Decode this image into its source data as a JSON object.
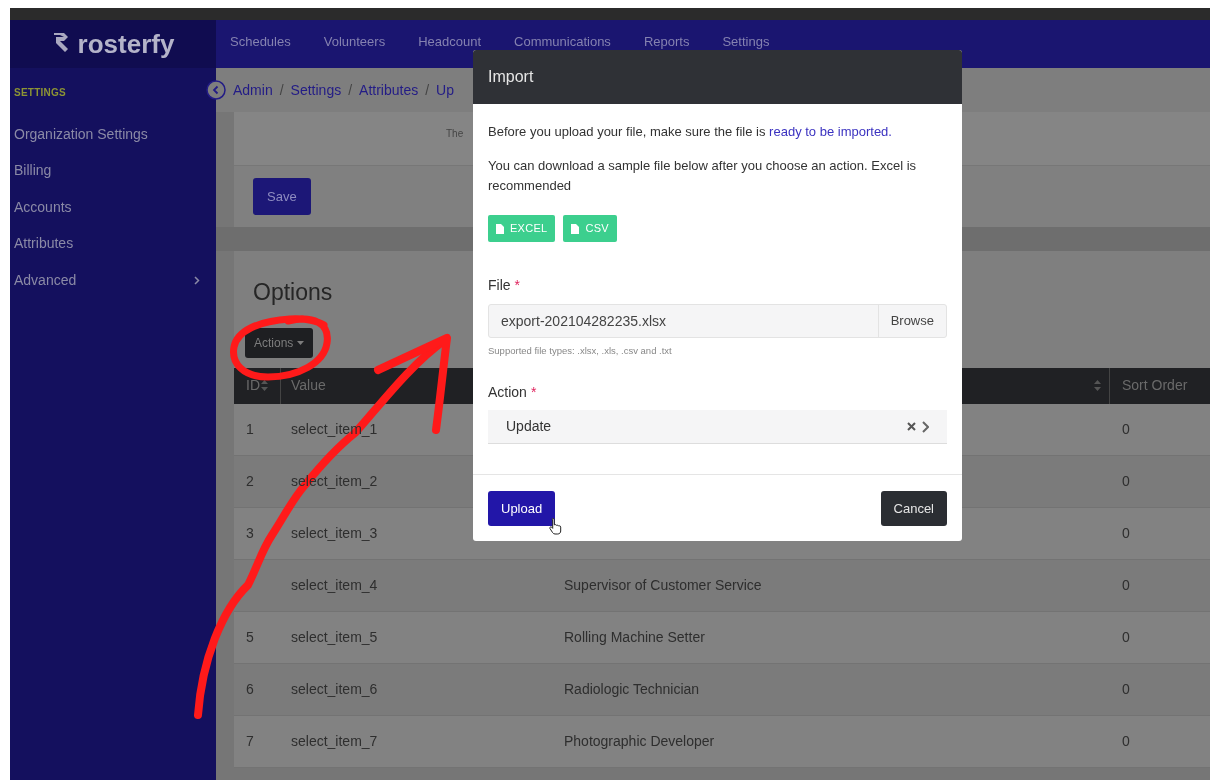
{
  "header": {
    "logo": "rosterfy",
    "nav": [
      {
        "label": "Schedules"
      },
      {
        "label": "Volunteers"
      },
      {
        "label": "Headcount"
      },
      {
        "label": "Communications"
      },
      {
        "label": "Reports"
      },
      {
        "label": "Settings"
      }
    ]
  },
  "sidebar": {
    "heading": "SETTINGS",
    "items": [
      {
        "label": "Organization Settings",
        "has_submenu": false
      },
      {
        "label": "Billing",
        "has_submenu": false
      },
      {
        "label": "Accounts",
        "has_submenu": false
      },
      {
        "label": "Attributes",
        "has_submenu": false
      },
      {
        "label": "Advanced",
        "has_submenu": true
      }
    ]
  },
  "breadcrumb": [
    {
      "kind": "link",
      "text": "Admin"
    },
    {
      "kind": "separator",
      "text": "/"
    },
    {
      "kind": "link",
      "text": "Settings"
    },
    {
      "kind": "separator",
      "text": "/"
    },
    {
      "kind": "link",
      "text": "Attributes"
    },
    {
      "kind": "separator",
      "text": "/"
    },
    {
      "kind": "link",
      "text": "Up"
    }
  ],
  "notice": "The",
  "save_button": "Save",
  "options": {
    "title": "Options",
    "actions_button": "Actions",
    "headers": {
      "id": "ID",
      "value": "Value",
      "sort_order": "Sort Order"
    },
    "rows": [
      {
        "id": "1",
        "value": "select_item_1",
        "sort_order": "0"
      },
      {
        "id": "2",
        "value": "select_item_2",
        "sort_order": "0"
      },
      {
        "id": "3",
        "value": "select_item_3",
        "sort_order": "0"
      },
      {
        "value": "select_item_4",
        "column_3": "Supervisor of Customer Service",
        "sort_order": "0"
      },
      {
        "id": "5",
        "value": "select_item_5",
        "column_3": "Rolling Machine Setter",
        "sort_order": "0"
      },
      {
        "id": "6",
        "value": "select_item_6",
        "column_3": "Radiologic Technician",
        "sort_order": "0"
      },
      {
        "id": "7",
        "value": "select_item_7",
        "column_3": "Photographic Developer",
        "sort_order": "0"
      }
    ]
  },
  "modal": {
    "title": "Import",
    "intro": "Before you upload your file, make sure the file is",
    "intro_link": "ready to be imported.",
    "sample_note": "You can download a sample file below after you choose an action. Excel is recommended",
    "sample_buttons": [
      "EXCEL",
      "CSV"
    ],
    "file": {
      "label": "File",
      "required_mark": "*",
      "value": "export-202104282235.xlsx",
      "browse": "Browse",
      "hint": "Supported file types: .xlsx, .xls, .csv and .txt"
    },
    "action": {
      "label": "Action",
      "required_mark": "*",
      "value": "Update"
    },
    "upload_button": "Upload",
    "cancel_button": "Cancel"
  }
}
